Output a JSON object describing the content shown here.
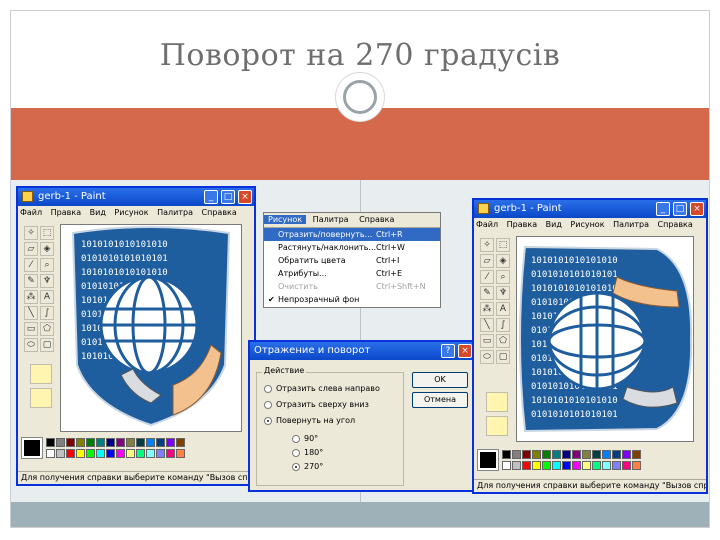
{
  "slide": {
    "title": "Поворот на 270 градусів"
  },
  "left_window": {
    "title": "gerb-1 - Paint",
    "menu": [
      "Файл",
      "Правка",
      "Вид",
      "Рисунок",
      "Палитра",
      "Справка"
    ],
    "status": "Для получения справки выберите команду \"Вызов справки\""
  },
  "right_window": {
    "title": "gerb-1 - Paint",
    "menu": [
      "Файл",
      "Правка",
      "Вид",
      "Рисунок",
      "Палитра",
      "Справка"
    ],
    "status": "Для получения справки выберите команду \"Вызов справки\""
  },
  "image_menu": {
    "bar": [
      "Рисунок",
      "Палитра",
      "Справка"
    ],
    "items": [
      {
        "label": "Отразить/повернуть...",
        "shortcut": "Ctrl+R"
      },
      {
        "label": "Растянуть/наклонить...",
        "shortcut": "Ctrl+W"
      },
      {
        "label": "Обратить цвета",
        "shortcut": "Ctrl+I"
      },
      {
        "label": "Атрибуты...",
        "shortcut": "Ctrl+E"
      },
      {
        "label": "Очистить",
        "shortcut": "Ctrl+Shft+N"
      },
      {
        "label": "Непрозрачный фон",
        "shortcut": ""
      }
    ]
  },
  "dialog": {
    "title": "Отражение и поворот",
    "group_label": "Действие",
    "options": [
      "Отразить слева направо",
      "Отразить сверху вниз",
      "Повернуть на угол"
    ],
    "angles": [
      "90°",
      "180°",
      "270°"
    ],
    "ok": "OK",
    "cancel": "Отмена",
    "help": "?",
    "close": "×"
  },
  "icons": {
    "minimize": "_",
    "maximize": "□",
    "close": "×"
  },
  "colors": {
    "accent_band": "#d4694c",
    "footer_bar": "#9fb1b8",
    "xp_title": "#0a47c9",
    "palette": [
      "#000000",
      "#808080",
      "#800000",
      "#808000",
      "#008000",
      "#008080",
      "#000080",
      "#800080",
      "#808040",
      "#004040",
      "#0080ff",
      "#004080",
      "#8000ff",
      "#804000",
      "#ffffff",
      "#c0c0c0",
      "#ff0000",
      "#ffff00",
      "#00ff00",
      "#00ffff",
      "#0000ff",
      "#ff00ff",
      "#ffff80",
      "#00ff80",
      "#80ffff",
      "#8080ff",
      "#ff0080",
      "#ff8040"
    ]
  }
}
